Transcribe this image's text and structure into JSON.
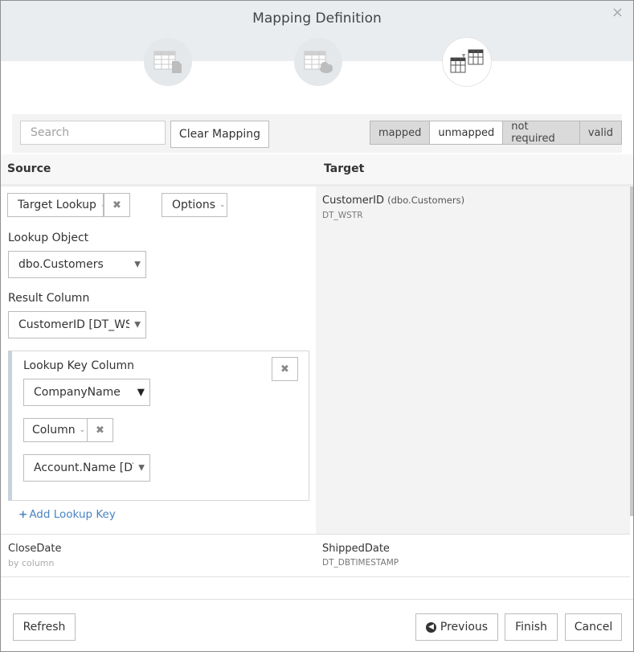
{
  "dialog": {
    "title": "Mapping Definition",
    "close_glyph": "×",
    "steps": [
      {
        "icon": "table-file-icon",
        "active": false
      },
      {
        "icon": "table-cloud-icon",
        "active": false
      },
      {
        "icon": "table-mapping-icon",
        "active": true
      }
    ]
  },
  "toolbar": {
    "search_placeholder": "Search",
    "clear_label": "Clear Mapping",
    "filters": [
      {
        "label": "mapped",
        "active": false
      },
      {
        "label": "unmapped",
        "active": true
      },
      {
        "label": "not required",
        "active": false
      },
      {
        "label": "valid",
        "active": false
      }
    ]
  },
  "columns": {
    "source": "Source",
    "target": "Target"
  },
  "row1": {
    "source": {
      "mapping_type": "Target Lookup",
      "remove_glyph": "✖",
      "options_label": "Options",
      "lookup_object_label": "Lookup Object",
      "lookup_object_value": "dbo.Customers",
      "result_column_label": "Result Column",
      "result_column_value": "CustomerID [DT_WSTR]",
      "key": {
        "label": "Lookup Key Column",
        "value": "CompanyName",
        "type": "Column",
        "column_value": "Account.Name [DT_WSTR]"
      },
      "add_key_label": "Add Lookup Key",
      "add_key_glyph": "+"
    },
    "target": {
      "name": "CustomerID",
      "table": "(dbo.Customers)",
      "type": "DT_WSTR"
    }
  },
  "row2": {
    "source": {
      "name": "CloseDate",
      "sub": "by column"
    },
    "target": {
      "name": "ShippedDate",
      "type": "DT_DBTIMESTAMP"
    }
  },
  "footer": {
    "refresh_label": "Refresh",
    "previous_label": "Previous",
    "finish_label": "Finish",
    "cancel_label": "Cancel"
  },
  "colors": {
    "header_bg": "#e9edf0",
    "link": "#4a84c2",
    "filter_inactive": "#dadada",
    "key_border": "#c7d2de"
  }
}
